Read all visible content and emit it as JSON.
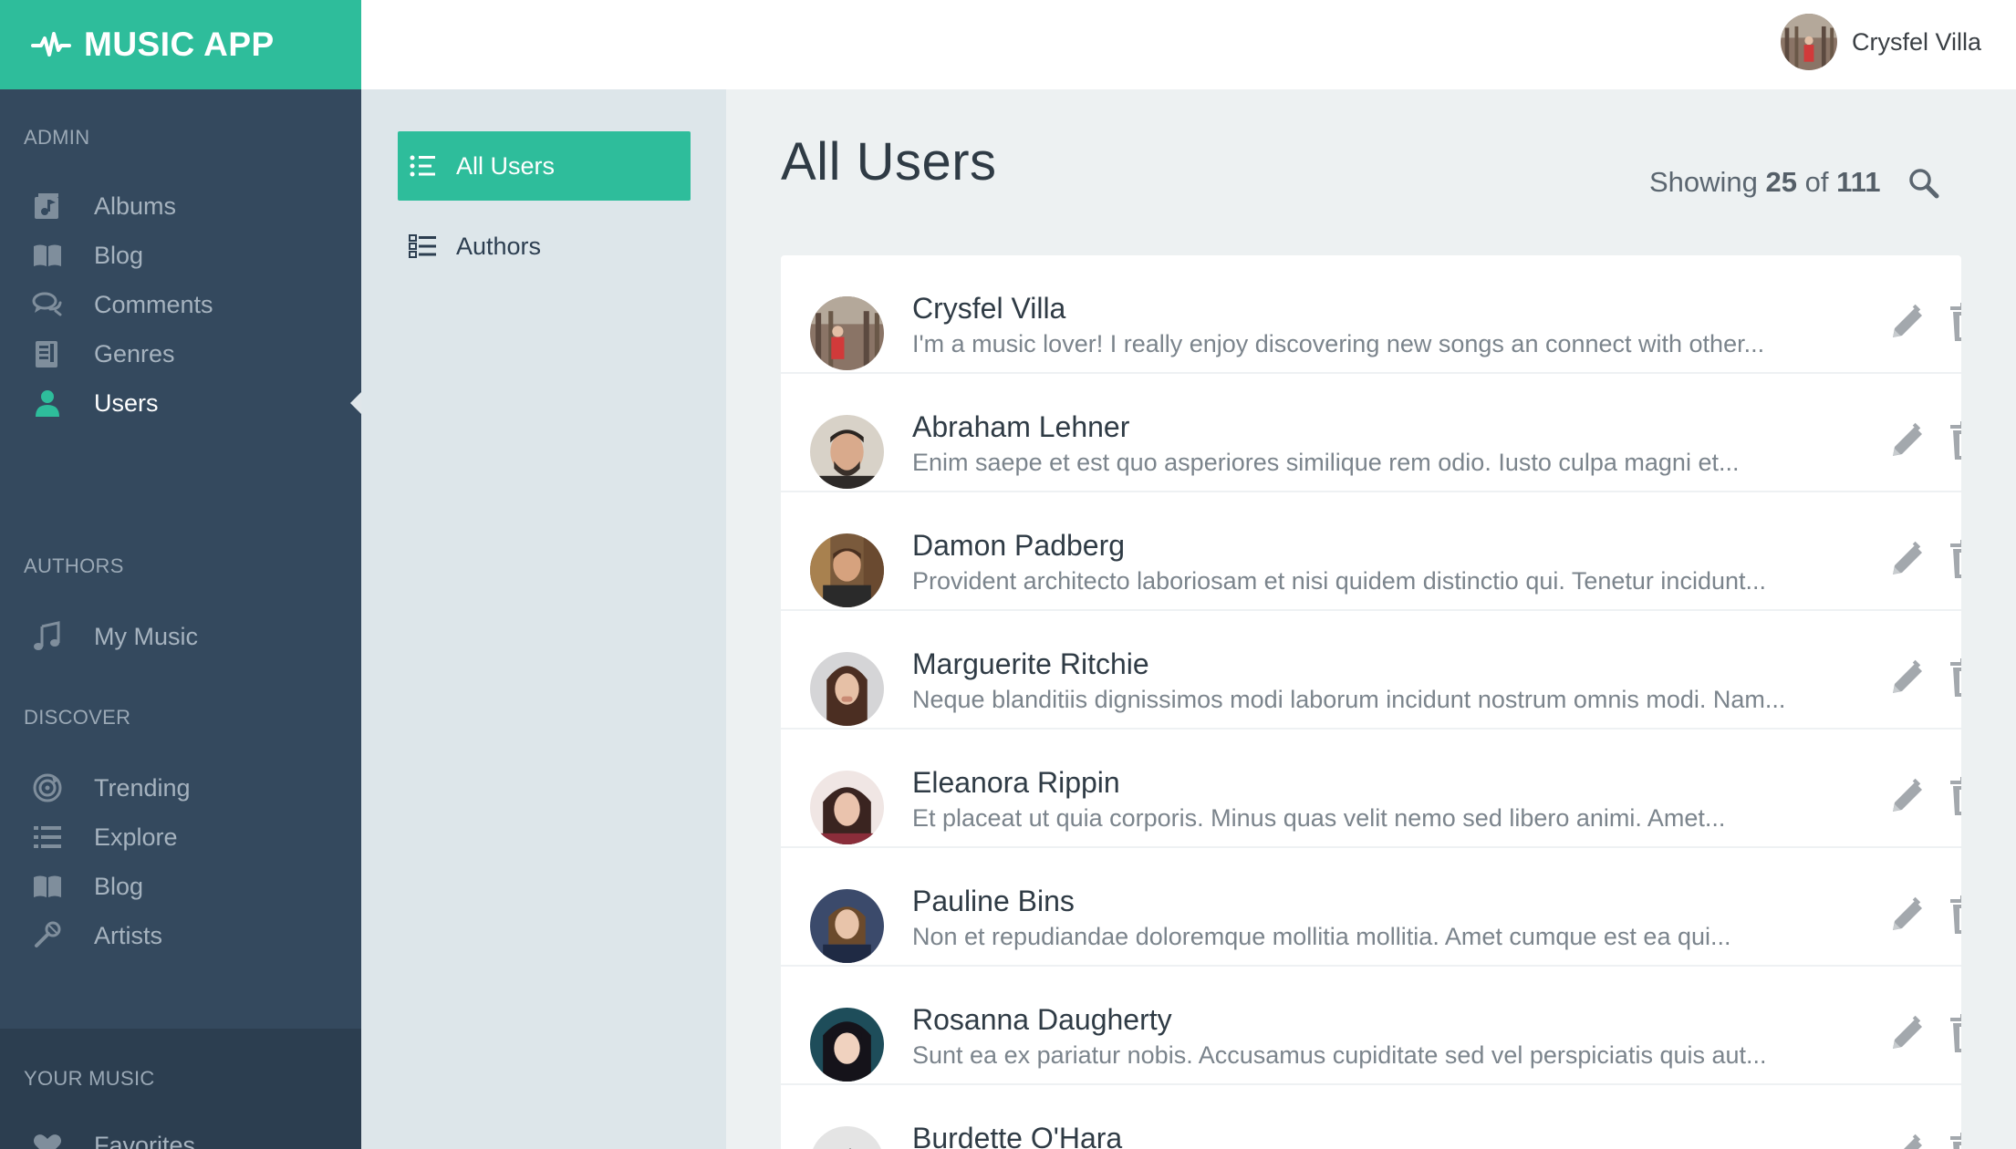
{
  "brand": {
    "title": "MUSIC APP"
  },
  "topbar": {
    "user_name": "Crysfel Villa"
  },
  "sidebar": {
    "sections": [
      {
        "label": "ADMIN",
        "items": [
          {
            "label": "Albums",
            "icon": "album-icon"
          },
          {
            "label": "Blog",
            "icon": "book-icon"
          },
          {
            "label": "Comments",
            "icon": "comments-icon"
          },
          {
            "label": "Genres",
            "icon": "genres-icon"
          },
          {
            "label": "Users",
            "icon": "user-icon",
            "active": true
          }
        ]
      },
      {
        "label": "AUTHORS",
        "items": [
          {
            "label": "My Music",
            "icon": "music-note-icon"
          }
        ]
      },
      {
        "label": "DISCOVER",
        "items": [
          {
            "label": "Trending",
            "icon": "trending-disc-icon"
          },
          {
            "label": "Explore",
            "icon": "list-icon"
          },
          {
            "label": "Blog",
            "icon": "book-icon"
          },
          {
            "label": "Artists",
            "icon": "microphone-icon"
          }
        ]
      },
      {
        "label": "YOUR MUSIC",
        "items": [
          {
            "label": "Favorites",
            "icon": "heart-icon"
          }
        ]
      }
    ]
  },
  "subnav": {
    "items": [
      {
        "label": "All Users",
        "icon": "list-icon",
        "active": true
      },
      {
        "label": "Authors",
        "icon": "list-icon"
      }
    ]
  },
  "main": {
    "title": "All Users",
    "showing_prefix": "Showing",
    "showing_count": "25",
    "showing_of": "of",
    "showing_total": "111",
    "users": [
      {
        "name": "Crysfel Villa",
        "description": "I'm a music lover! I really enjoy discovering new songs an connect with other..."
      },
      {
        "name": "Abraham Lehner",
        "description": "Enim saepe et est quo asperiores similique rem odio. Iusto culpa magni et..."
      },
      {
        "name": "Damon Padberg",
        "description": "Provident architecto laboriosam et nisi quidem distinctio qui. Tenetur incidunt..."
      },
      {
        "name": "Marguerite Ritchie",
        "description": "Neque blanditiis dignissimos modi laborum incidunt nostrum omnis modi. Nam..."
      },
      {
        "name": "Eleanora Rippin",
        "description": "Et placeat ut quia corporis. Minus quas velit nemo sed libero animi. Amet..."
      },
      {
        "name": "Pauline Bins",
        "description": "Non et repudiandae doloremque mollitia mollitia. Amet cumque est ea qui..."
      },
      {
        "name": "Rosanna Daugherty",
        "description": "Sunt ea ex pariatur nobis. Accusamus cupiditate sed vel perspiciatis quis aut..."
      },
      {
        "name": "Burdette O'Hara",
        "description": ""
      }
    ]
  },
  "colors": {
    "accent": "#2ebd9b",
    "sidebar": "#34495e",
    "sidebar_dark": "#2c3e50",
    "subnav": "#dde6ea",
    "content_bg": "#edf1f2"
  }
}
